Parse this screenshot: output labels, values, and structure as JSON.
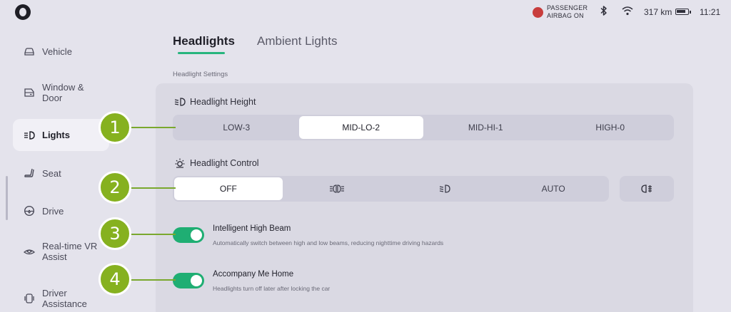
{
  "status_bar": {
    "logo_icon": "brand-logo",
    "airbag_line1": "PASSENGER",
    "airbag_line2": "AIRBAG ON",
    "airbag_icon": "airbag-off-icon",
    "bluetooth_icon": "bluetooth-icon",
    "wifi_icon": "wifi-icon",
    "range": "317 km",
    "battery_icon": "battery-icon",
    "time": "11:21"
  },
  "sidebar": {
    "items": [
      {
        "label": "Vehicle",
        "icon": "car-icon"
      },
      {
        "label": "Window & Door",
        "icon": "door-icon"
      },
      {
        "label": "Lights",
        "icon": "headlight-icon",
        "active": true
      },
      {
        "label": "Seat",
        "icon": "seat-icon"
      },
      {
        "label": "Drive",
        "icon": "steering-wheel-icon"
      },
      {
        "label": "Real-time VR Assist",
        "icon": "vr-assist-icon"
      },
      {
        "label": "Driver Assistance",
        "icon": "driver-assist-icon"
      }
    ]
  },
  "tabs": [
    {
      "label": "Headlights",
      "active": true
    },
    {
      "label": "Ambient Lights",
      "active": false
    }
  ],
  "section_caption": "Headlight Settings",
  "headlight_height": {
    "title": "Headlight Height",
    "icon": "headlight-height-icon",
    "options": [
      "LOW-3",
      "MID-LO-2",
      "MID-HI-1",
      "HIGH-0"
    ],
    "selected": "MID-LO-2"
  },
  "headlight_control": {
    "title": "Headlight Control",
    "icon": "sun-icon",
    "options": [
      {
        "label": "OFF",
        "icon": ""
      },
      {
        "label": "",
        "icon": "parking-lights-icon"
      },
      {
        "label": "",
        "icon": "low-beam-icon"
      },
      {
        "label": "AUTO",
        "icon": ""
      }
    ],
    "selected": "OFF",
    "extra_button_icon": "rear-fog-light-icon"
  },
  "toggles": [
    {
      "title": "Intelligent High Beam",
      "description": "Automatically switch between high and low beams, reducing nighttime driving hazards",
      "on": true
    },
    {
      "title": "Accompany Me Home",
      "description": "Headlights turn off later after locking the car",
      "on": true
    }
  ],
  "callouts": [
    "1",
    "2",
    "3",
    "4"
  ],
  "colors": {
    "accent": "#27b57e",
    "toggle_on": "#1fae73",
    "callout": "#86b11f",
    "airbag": "#c83d3d"
  }
}
